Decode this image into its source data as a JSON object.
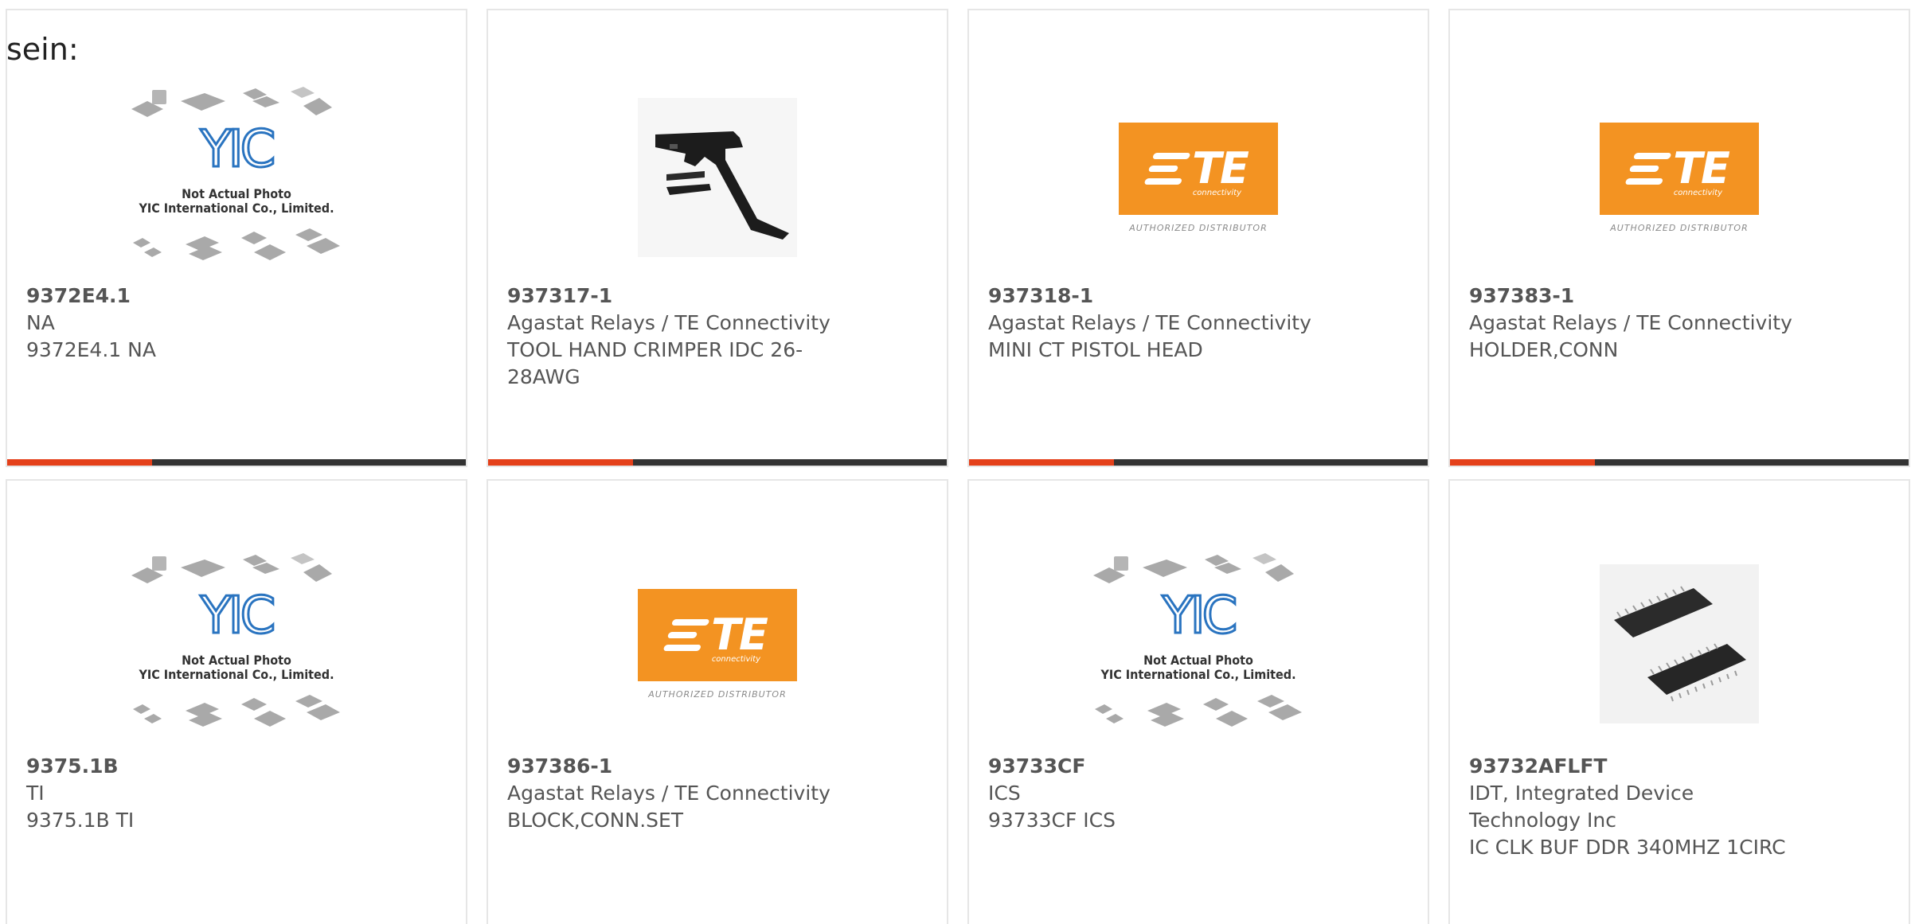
{
  "lead_text": "sein:",
  "products": [
    {
      "part_number": "9372E4.1",
      "manufacturer": "NA",
      "description": "9372E4.1 NA",
      "image": "yic-placeholder",
      "image_text": [
        "Not Actual Photo",
        "YIC International Co., Limited."
      ],
      "logo_text": "YIC"
    },
    {
      "part_number": "937317-1",
      "manufacturer": "Agastat Relays / TE Connectivity",
      "description": "TOOL HAND CRIMPER IDC 26-28AWG",
      "image": "hand-crimper-photo"
    },
    {
      "part_number": "937318-1",
      "manufacturer": "Agastat Relays / TE Connectivity",
      "description": "MINI CT PISTOL HEAD",
      "image": "te-logo",
      "logo_text": "TE",
      "logo_subtext": "connectivity",
      "logo_caption": "AUTHORIZED DISTRIBUTOR"
    },
    {
      "part_number": "937383-1",
      "manufacturer": "Agastat Relays / TE Connectivity",
      "description": "HOLDER,CONN",
      "image": "te-logo",
      "logo_text": "TE",
      "logo_subtext": "connectivity",
      "logo_caption": "AUTHORIZED DISTRIBUTOR"
    },
    {
      "part_number": "9375.1B",
      "manufacturer": "TI",
      "description": "9375.1B TI",
      "image": "yic-placeholder",
      "image_text": [
        "Not Actual Photo",
        "YIC International Co., Limited."
      ],
      "logo_text": "YIC"
    },
    {
      "part_number": "937386-1",
      "manufacturer": "Agastat Relays / TE Connectivity",
      "description": "BLOCK,CONN.SET",
      "image": "te-logo",
      "logo_text": "TE",
      "logo_subtext": "connectivity",
      "logo_caption": "AUTHORIZED DISTRIBUTOR"
    },
    {
      "part_number": "93733CF",
      "manufacturer": "ICS",
      "description": "93733CF ICS",
      "image": "yic-placeholder",
      "image_text": [
        "Not Actual Photo",
        "YIC International Co., Limited."
      ],
      "logo_text": "YIC"
    },
    {
      "part_number": "93732AFLFT",
      "manufacturer": "IDT, Integrated Device Technology Inc",
      "description": "IC CLK BUF DDR 340MHZ 1CIRC",
      "image": "ic-chip-photo"
    }
  ],
  "colors": {
    "accent_red": "#e4401a",
    "accent_dark": "#333333",
    "te_orange": "#f39322",
    "yic_blue": "#2a74c0",
    "card_border": "#e6e6e6",
    "text": "#555555"
  }
}
